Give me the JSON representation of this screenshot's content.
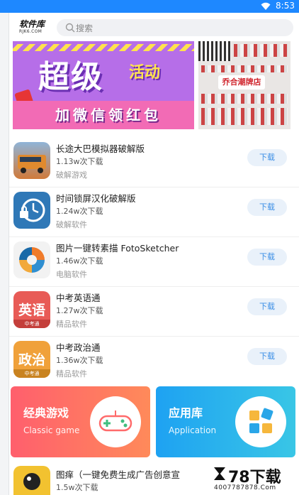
{
  "status_bar": {
    "time": "8:53"
  },
  "header": {
    "logo_cn": "软件库",
    "logo_en": "RJK6.COM",
    "search_placeholder": "搜索"
  },
  "banner": {
    "promo_title": "超级",
    "promo_highlight": "活动",
    "promo_subtitle": "加微信领红包",
    "store_name": "乔合潮牌店"
  },
  "list": [
    {
      "name": "长途大巴模拟器破解版",
      "downloads": "1.13w次下载",
      "category": "破解游戏",
      "button": "下载",
      "icon": "bus-icon",
      "icon_bg": "#4a6a8a"
    },
    {
      "name": "时间锁屏汉化破解版",
      "downloads": "1.24w次下载",
      "category": "破解软件",
      "button": "下载",
      "icon": "clock-lock-icon",
      "icon_bg": "#2f78b7"
    },
    {
      "name": "图片一键转素描 FotoSketcher",
      "downloads": "1.46w次下载",
      "category": "电脑软件",
      "button": "下载",
      "icon": "fotosketcher-icon",
      "icon_bg": "#f2f2f2"
    },
    {
      "name": "中考英语通",
      "downloads": "1.27w次下载",
      "category": "精品软件",
      "button": "下载",
      "icon": "english-icon",
      "icon_bg": "#e85b56",
      "icon_text": "英语",
      "icon_sub": "中考通"
    },
    {
      "name": "中考政治通",
      "downloads": "1.36w次下载",
      "category": "精品软件",
      "button": "下载",
      "icon": "politics-icon",
      "icon_bg": "#f0a13a",
      "icon_text": "政治",
      "icon_sub": "中考通"
    }
  ],
  "cards": {
    "games": {
      "title": "经典游戏",
      "subtitle": "Classic game"
    },
    "apps": {
      "title": "应用库",
      "subtitle": "Application"
    }
  },
  "last_item": {
    "name": "图痒（一键免费生成广告创意宣",
    "downloads": "1.5w次下载"
  },
  "watermark": {
    "brand": "78下载",
    "url": "4007787878.Com"
  },
  "colors": {
    "status_bar": "#1e88ff",
    "download_text": "#3a8ee6",
    "download_bg": "#e9f1fa"
  }
}
